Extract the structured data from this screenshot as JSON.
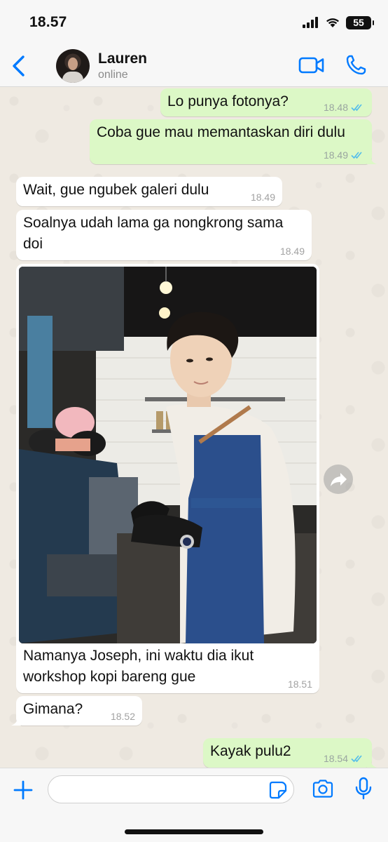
{
  "status_bar": {
    "time": "18.57",
    "battery": "55"
  },
  "header": {
    "back": "Back",
    "contact_name": "Lauren",
    "contact_status": "online"
  },
  "messages": [
    {
      "direction": "out",
      "text": "Lo punya fotonya?",
      "time": "18.48",
      "read": true
    },
    {
      "direction": "out",
      "text": "Coba gue mau memantaskan diri dulu",
      "time": "18.49",
      "read": true
    },
    {
      "direction": "in",
      "text": "Wait, gue ngubek galeri dulu",
      "time": "18.49"
    },
    {
      "direction": "in",
      "text_line1": "Soalnya udah lama ga nongkrong sama",
      "text_line2": "doi",
      "time": "18.49"
    },
    {
      "direction": "in",
      "type": "image",
      "caption_line1": "Namanya Joseph, ini waktu dia ikut",
      "caption_line2": "workshop kopi bareng gue",
      "time": "18.51"
    },
    {
      "direction": "in",
      "text": "Gimana?",
      "time": "18.52"
    },
    {
      "direction": "out",
      "text": "Kayak pulu2",
      "time": "18.54",
      "read": true
    }
  ],
  "input": {
    "placeholder": ""
  },
  "colors": {
    "accent": "#007aff",
    "outgoing": "#dcf8c6",
    "incoming": "#ffffff",
    "read_tick": "#53bdeb",
    "chat_bg": "#efeae2"
  },
  "icons": [
    "back-chevron-icon",
    "video-call-icon",
    "phone-icon",
    "forward-icon",
    "plus-icon",
    "sticker-icon",
    "camera-icon",
    "microphone-icon"
  ]
}
